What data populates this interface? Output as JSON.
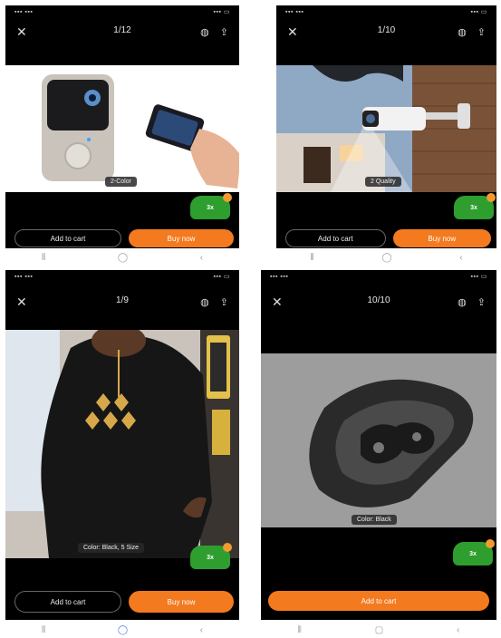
{
  "screens": [
    {
      "counter": "1/12",
      "variant": "2-Color",
      "badge": "3x",
      "cart_label": "Add to cart",
      "buy_label": "Buy now"
    },
    {
      "counter": "1/10",
      "variant": "2 Quality",
      "badge": "3x",
      "cart_label": "Add to cart",
      "buy_label": "Buy now"
    },
    {
      "counter": "1/9",
      "variant": "Color: Black, 5 Size",
      "badge": "3x",
      "cart_label": "Add to cart",
      "buy_label": "Buy now"
    },
    {
      "counter": "10/10",
      "variant": "Color: Black",
      "badge": "3x",
      "cart_label": "Add to cart"
    }
  ],
  "nav_icons": [
    "menu-icon",
    "home-icon",
    "back-icon"
  ],
  "colors": {
    "accent": "#f37a1f",
    "badge_green": "#2e9e2e",
    "background": "#000000"
  }
}
